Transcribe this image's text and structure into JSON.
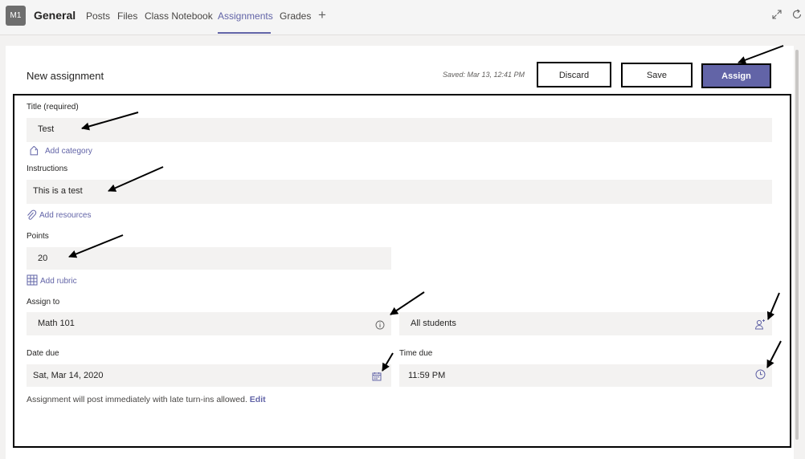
{
  "header": {
    "avatar": "M1",
    "channel": "General",
    "tabs": [
      "Posts",
      "Files",
      "Class Notebook",
      "Assignments",
      "Grades"
    ],
    "active_tab": "Assignments",
    "add_tab_icon": "plus-icon",
    "expand_icon": "expand-icon",
    "refresh_icon": "refresh-icon"
  },
  "form": {
    "heading": "New assignment",
    "saved_text": "Saved: Mar 13, 12:41 PM",
    "discard_label": "Discard",
    "save_label": "Save",
    "assign_label": "Assign",
    "title_label": "Title (required)",
    "title_value": "Test",
    "add_category": "Add category",
    "instructions_label": "Instructions",
    "instructions_value": "This is a test",
    "add_resources": "Add resources",
    "points_label": "Points",
    "points_value": "20",
    "add_rubric": "Add rubric",
    "assign_to_label": "Assign to",
    "class_value": "Math 101",
    "students_value": "All students",
    "date_due_label": "Date due",
    "date_due_value": "Sat, Mar 14, 2020",
    "time_due_label": "Time due",
    "time_due_value": "11:59 PM",
    "note": "Assignment will post immediately with late turn-ins allowed.",
    "note_edit": "Edit"
  },
  "colors": {
    "accent": "#6264a7",
    "field_bg": "#f3f2f1",
    "page_bg": "#f3f2f1"
  }
}
